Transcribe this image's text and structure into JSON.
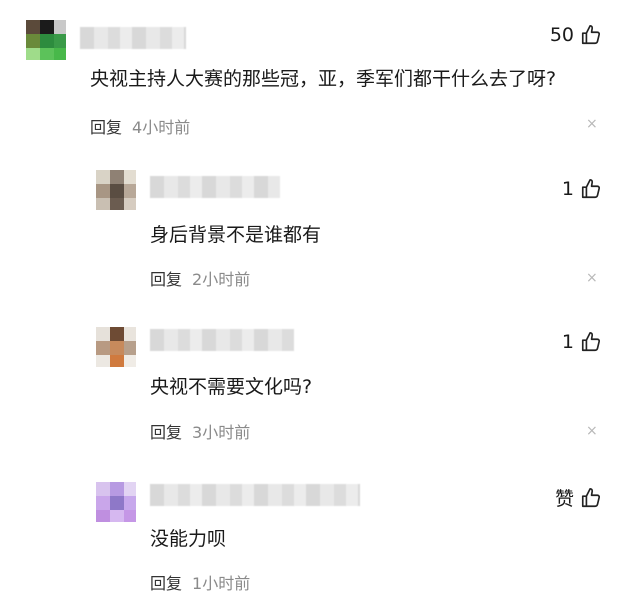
{
  "comments": [
    {
      "text": "央视主持人大赛的那些冠，亚，季军们都干什么去了呀?",
      "likes": "50",
      "reply_label": "回复",
      "time": "4小时前",
      "close": "×"
    },
    {
      "text": "身后背景不是谁都有",
      "likes": "1",
      "reply_label": "回复",
      "time": "2小时前",
      "close": "×"
    },
    {
      "text": "央视不需要文化吗?",
      "likes": "1",
      "reply_label": "回复",
      "time": "3小时前",
      "close": "×"
    },
    {
      "text": "没能力呗",
      "likes": "赞",
      "reply_label": "回复",
      "time": "1小时前",
      "close": "×"
    }
  ],
  "colors": {
    "text": "#1a1a1a",
    "time": "#8a8a8a",
    "close": "#b8b8b8"
  },
  "icons": {
    "like": "thumbs-up-icon",
    "close": "close-icon"
  }
}
